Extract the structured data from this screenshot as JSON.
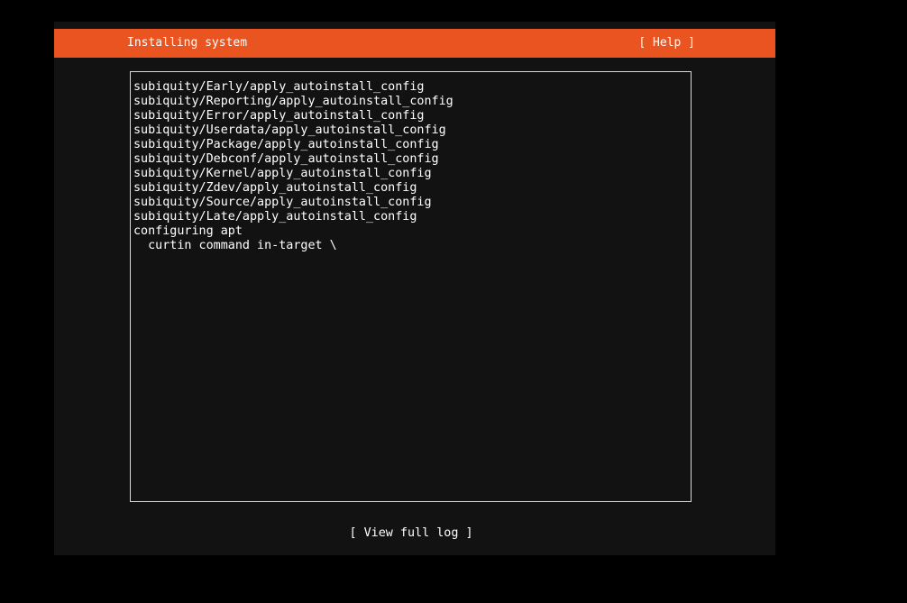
{
  "header": {
    "title": "Installing system",
    "help_label": "[ Help ]",
    "bg_color": "#e95420"
  },
  "log": {
    "lines": [
      "subiquity/Early/apply_autoinstall_config",
      "subiquity/Reporting/apply_autoinstall_config",
      "subiquity/Error/apply_autoinstall_config",
      "subiquity/Userdata/apply_autoinstall_config",
      "subiquity/Package/apply_autoinstall_config",
      "subiquity/Debconf/apply_autoinstall_config",
      "subiquity/Kernel/apply_autoinstall_config",
      "subiquity/Zdev/apply_autoinstall_config",
      "subiquity/Source/apply_autoinstall_config",
      "subiquity/Late/apply_autoinstall_config",
      "configuring apt",
      "  curtin command in-target \\"
    ]
  },
  "footer": {
    "view_log_label": "[ View full log ]"
  }
}
